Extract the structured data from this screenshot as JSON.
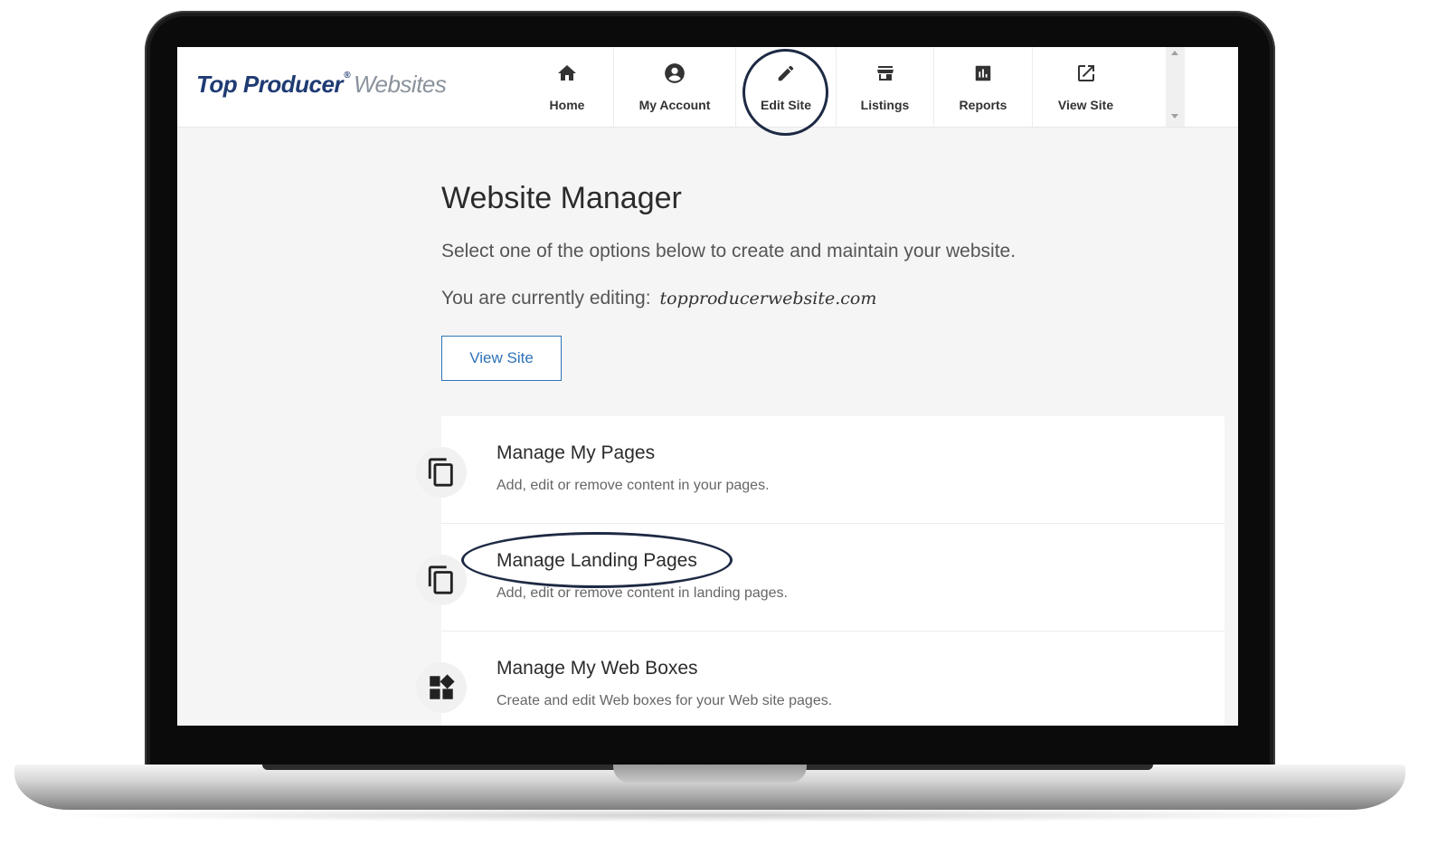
{
  "logo": {
    "part1": "Top Producer",
    "registered": "®",
    "part2": "Websites"
  },
  "nav": [
    {
      "label": "Home",
      "icon": "home-icon"
    },
    {
      "label": "My Account",
      "icon": "account-circle-icon"
    },
    {
      "label": "Edit Site",
      "icon": "pencil-icon"
    },
    {
      "label": "Listings",
      "icon": "storefront-icon"
    },
    {
      "label": "Reports",
      "icon": "bar-chart-icon"
    },
    {
      "label": "View Site",
      "icon": "external-link-icon"
    }
  ],
  "main": {
    "title": "Website Manager",
    "intro": "Select one of the options below to create and maintain your website.",
    "editing_label": "You are currently editing:",
    "editing_domain": "topproducerwebsite.com",
    "view_site_button": "View Site"
  },
  "options": [
    {
      "title": "Manage My Pages",
      "description": "Add, edit or remove content in your pages.",
      "icon": "copy-pages-icon"
    },
    {
      "title": "Manage Landing Pages",
      "description": "Add, edit or remove content in landing pages.",
      "icon": "copy-pages-icon"
    },
    {
      "title": "Manage My Web Boxes",
      "description": "Create and edit Web boxes for your Web site pages.",
      "icon": "widgets-icon"
    }
  ],
  "colors": {
    "brand_blue": "#1f3b73",
    "link_blue": "#2e73b8",
    "highlight": "#1e2a44"
  }
}
